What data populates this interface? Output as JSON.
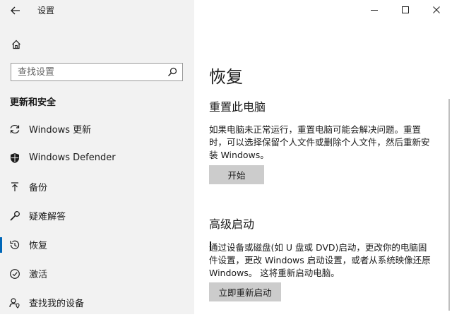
{
  "window": {
    "title": "设置",
    "controls": [
      {
        "name": "minimize",
        "icon": "minimize-icon"
      },
      {
        "name": "maximize",
        "icon": "maximize-icon"
      },
      {
        "name": "close",
        "icon": "close-icon"
      }
    ]
  },
  "sidebar": {
    "home_icon": "home-icon",
    "search": {
      "placeholder": "查找设置",
      "value": "",
      "icon": "search-icon"
    },
    "section_heading": "更新和安全",
    "items": [
      {
        "label": "Windows 更新",
        "icon": "sync-icon",
        "active": false
      },
      {
        "label": "Windows Defender",
        "icon": "shield-icon",
        "active": false
      },
      {
        "label": "备份",
        "icon": "backup-arrow-icon",
        "active": false
      },
      {
        "label": "疑难解答",
        "icon": "wrench-icon",
        "active": false
      },
      {
        "label": "恢复",
        "icon": "recovery-icon",
        "active": true
      },
      {
        "label": "激活",
        "icon": "activation-check-icon",
        "active": false
      },
      {
        "label": "查找我的设备",
        "icon": "person-location-icon",
        "active": false
      }
    ]
  },
  "main": {
    "title": "恢复",
    "reset": {
      "heading": "重置此电脑",
      "description": "如果电脑未正常运行，重置电脑可能会解决问题。重置时，可以选择保留个人文件或删除个人文件，然后重新安装 Windows。",
      "button": "开始"
    },
    "advanced": {
      "heading": "高级启动",
      "description": "通过设备或磁盘(如 U 盘或 DVD)启动，更改你的电脑固件设置，更改 Windows 启动设置，或者从系统映像还原 Windows。 这将重新启动电脑。",
      "button": "立即重新启动"
    }
  },
  "colors": {
    "sidebar_bg": "#f2f2f2",
    "accent": "#0067b8",
    "button_bg": "#cccccc"
  }
}
